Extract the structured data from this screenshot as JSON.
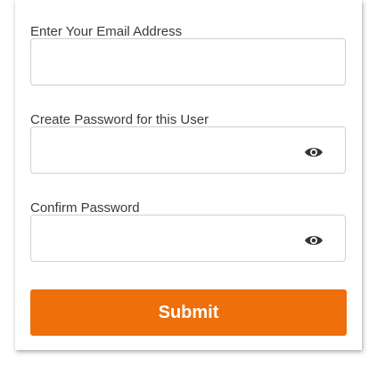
{
  "form": {
    "email": {
      "label": "Enter Your Email Address",
      "value": "",
      "placeholder": ""
    },
    "password": {
      "label": "Create Password for this User",
      "value": "",
      "placeholder": "",
      "toggle_icon": "eye-icon"
    },
    "confirm_password": {
      "label": "Confirm Password",
      "value": "",
      "placeholder": "",
      "toggle_icon": "eye-icon"
    },
    "submit_label": "Submit"
  },
  "colors": {
    "accent": "#EE6F0B",
    "label_text": "#3A3A3A",
    "input_border": "#CFCFCF",
    "icon": "#333333"
  }
}
